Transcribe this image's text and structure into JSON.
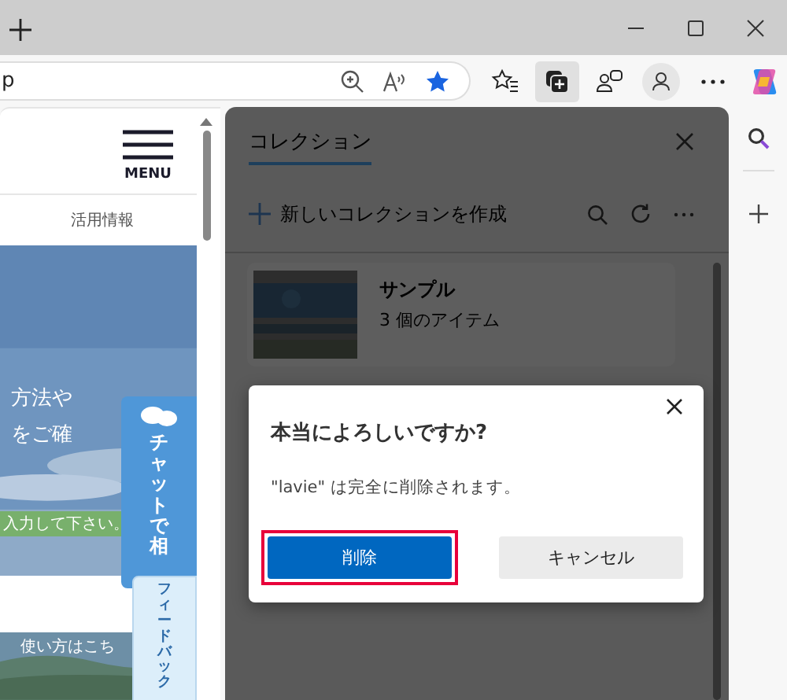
{
  "browser": {
    "address": "p",
    "toolbar": [
      {
        "kind": "favorites",
        "selected": false
      },
      {
        "kind": "collections",
        "selected": true
      },
      {
        "kind": "extensions",
        "selected": false
      },
      {
        "kind": "profile",
        "selected": false
      },
      {
        "kind": "more",
        "selected": false
      },
      {
        "kind": "copilot",
        "selected": false
      }
    ]
  },
  "page": {
    "menu_label": "MENU",
    "nav_link": "活用情報",
    "hero_lines": [
      "方法や",
      "をご確"
    ],
    "input_hint": "入力して下さい。",
    "banner_text": "使い方はこち",
    "chat_tab": "チャットで相",
    "feedback_tab": "フィードバック"
  },
  "collections_panel": {
    "title": "コレクション",
    "new_collection": "新しいコレクションを作成",
    "collections": [
      {
        "name": "サンプル",
        "count": "3 個のアイテム"
      }
    ]
  },
  "dialog": {
    "title": "本当によろしいですか?",
    "message": "\"lavie\" は完全に削除されます。",
    "buttons": [
      {
        "label": "削除",
        "kind": "primary",
        "highlighted": true
      },
      {
        "label": "キャンセル",
        "kind": "secondary",
        "highlighted": false
      }
    ]
  }
}
